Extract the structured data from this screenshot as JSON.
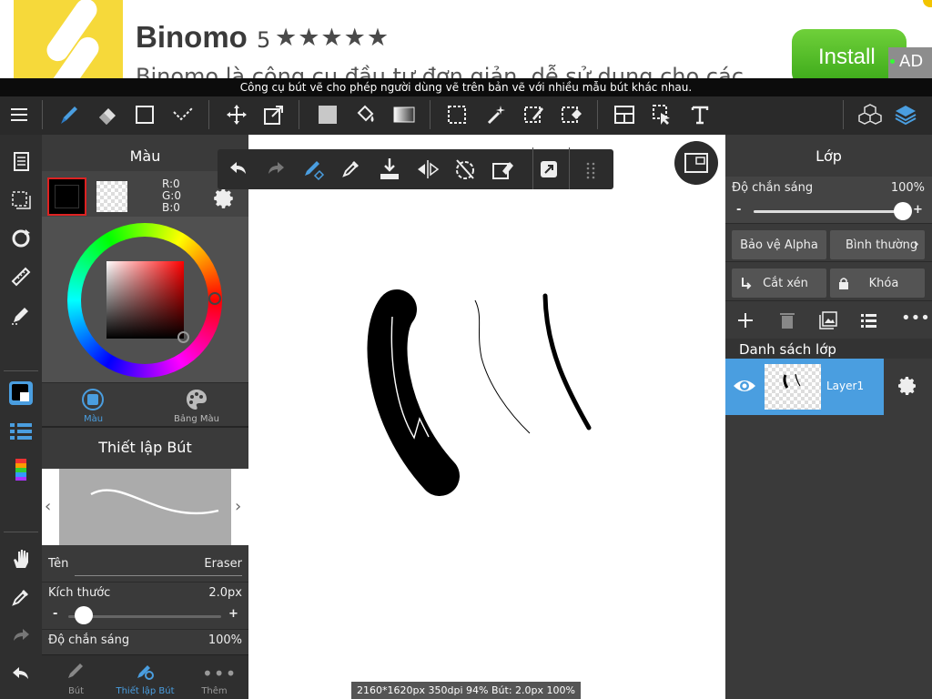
{
  "ad": {
    "title": "Binomo",
    "rating": "5",
    "stars": "★★★★★",
    "description": "Binomo là công cụ đầu tư đơn giản, dễ sử dụng cho các",
    "install_label": "Install",
    "badge": "AD"
  },
  "tooltip": "Công cụ bút vẽ cho phép người dùng vẽ trên bản vẽ với nhiều mẫu bút khác nhau.",
  "color_panel": {
    "title": "Màu",
    "r": "R:0",
    "g": "G:0",
    "b": "B:0",
    "tab_color": "Màu",
    "tab_palette": "Bảng Màu"
  },
  "brush_settings": {
    "title": "Thiết lập Bút",
    "name_label": "Tên",
    "name_value": "Eraser",
    "size_label": "Kích thước",
    "size_value": "2.0px",
    "size_minus": "-",
    "size_plus": "+",
    "opacity_label": "Độ chắn sáng",
    "opacity_value": "100%",
    "size_fraction": 0.1
  },
  "bottom_tabs": {
    "brush": "Bút",
    "brush_settings": "Thiết lập Bút",
    "more": "Thêm"
  },
  "status_bar": "2160*1620px 350dpi 94% Bút: 2.0px 100%",
  "layer_panel": {
    "title": "Lớp",
    "opacity_label": "Độ chắn sáng",
    "opacity_value": "100%",
    "opacity_minus": "-",
    "opacity_plus": "+",
    "opacity_fraction": 1.0,
    "protect_alpha": "Bảo vệ Alpha",
    "blend_mode": "Bình thường",
    "clipping": "Cắt xén",
    "lock": "Khóa",
    "list_title": "Danh sách lớp",
    "layer_name": "Layer1"
  },
  "colors": {
    "accent": "#4a9ee0",
    "toolbar_bg": "#2a2a2a",
    "panel_bg": "#3a3a3a"
  }
}
